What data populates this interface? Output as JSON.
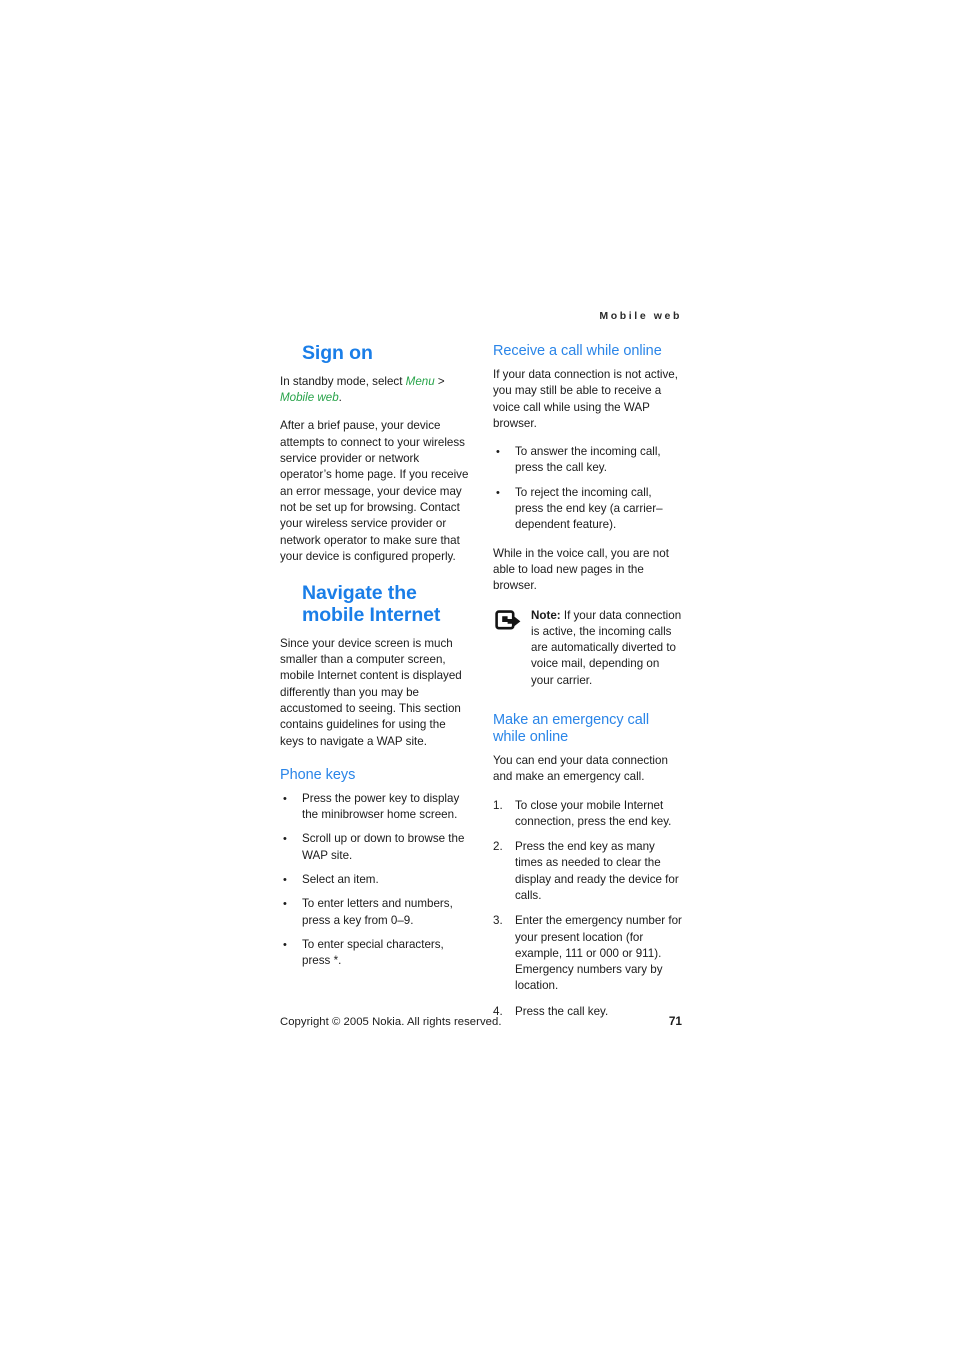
{
  "header": {
    "running_head": "Mobile web"
  },
  "colors": {
    "heading_blue_bold": "#1a7ee8",
    "heading_blue_regular": "#2a85e8",
    "emphasis_green": "#27a349",
    "body_text": "#1b1b1b"
  },
  "left_column": {
    "chapter_heading": "Sign on",
    "intro_prefix": "In standby mode, select ",
    "intro_menu": "Menu",
    "intro_gt": " > ",
    "intro_mobile_web": "Mobile web",
    "intro_suffix": ".",
    "paragraph_1": "After a brief pause, your device attempts to connect to your wireless service provider or network operator’s home page. If you receive an error message, your device may not be set up for browsing. Contact your wireless service provider or network operator to make sure that your device is configured properly.",
    "chapter_heading_2": "Navigate the mobile Internet",
    "paragraph_2": "Since your device screen is much smaller than a computer screen, mobile Internet content is displayed differently than you may be accustomed to seeing. This section contains guidelines for using the keys to navigate a WAP site.",
    "section_heading": "Phone keys",
    "bullet_marker": "•",
    "bullets": [
      "Press the power key to display the minibrowser home screen.",
      "Scroll up or down to browse the WAP site.",
      "Select an item.",
      "To enter letters and numbers, press a key from 0–9.",
      "To enter special characters, press *."
    ]
  },
  "right_column": {
    "section_heading_1": "Receive a call while online",
    "paragraph_1": "If your data connection is not active, you may still be able to receive a voice call while using the WAP browser.",
    "bullet_marker": "•",
    "bullets": [
      "To answer the incoming call, press the call key.",
      "To reject the incoming call, press the end key (a carrier–dependent feature)."
    ],
    "paragraph_2": "While in the voice call, you are not able to load new pages in the browser.",
    "note": {
      "icon": "note-arrow-icon",
      "label": "Note:",
      "text": " If your data connection is active, the incoming calls are automatically diverted to voice mail, depending on your carrier."
    },
    "section_heading_2": "Make an emergency call while online",
    "paragraph_3": "You can end your data connection and make an emergency call.",
    "steps": [
      {
        "num": "1.",
        "text": "To close your mobile Internet connection, press the end key."
      },
      {
        "num": "2.",
        "text": "Press the end key as many times as needed to clear the display and ready the device for calls."
      },
      {
        "num": "3.",
        "text": "Enter the emergency number for your present location (for example, 111 or 000 or 911). Emergency numbers vary by location."
      },
      {
        "num": "4.",
        "text": "Press the call key."
      }
    ]
  },
  "footer": {
    "copyright": "Copyright © 2005 Nokia. All rights reserved.",
    "page_number": "71"
  }
}
